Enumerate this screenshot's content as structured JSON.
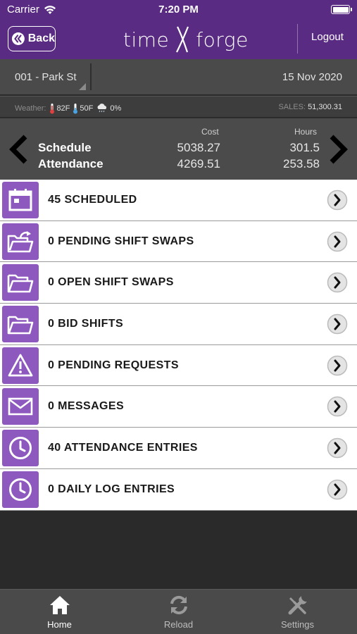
{
  "status_bar": {
    "carrier": "Carrier",
    "time": "7:20 PM"
  },
  "nav": {
    "back_label": "Back",
    "logo_left": "time",
    "logo_right": "forge",
    "logout_label": "Logout",
    "color": "#5a2b82"
  },
  "store_bar": {
    "store": "001 - Park St",
    "date": "15 Nov 2020"
  },
  "weather_bar": {
    "weather_label": "Weather:",
    "high": "82F",
    "low": "50F",
    "precip": "0%",
    "sales_label": "SALES:",
    "sales_value": "51,300.31"
  },
  "summary": {
    "cost_header": "Cost",
    "hours_header": "Hours",
    "rows": [
      {
        "label": "Schedule",
        "cost": "5038.27",
        "hours": "301.5"
      },
      {
        "label": "Attendance",
        "cost": "4269.51",
        "hours": "253.58"
      }
    ]
  },
  "list": {
    "accent": "#8d59be",
    "items": [
      {
        "label": "45 SCHEDULED",
        "icon": "calendar-icon"
      },
      {
        "label": "0 PENDING SHIFT SWAPS",
        "icon": "folder-swap-icon"
      },
      {
        "label": "0 OPEN SHIFT SWAPS",
        "icon": "folder-open-icon"
      },
      {
        "label": "0 BID SHIFTS",
        "icon": "folder-open-icon"
      },
      {
        "label": "0 PENDING REQUESTS",
        "icon": "warning-icon"
      },
      {
        "label": "0 MESSAGES",
        "icon": "envelope-icon"
      },
      {
        "label": "40 ATTENDANCE ENTRIES",
        "icon": "clock-icon"
      },
      {
        "label": "0 DAILY LOG ENTRIES",
        "icon": "clock-icon"
      }
    ]
  },
  "tabbar": {
    "tabs": [
      {
        "label": "Home",
        "icon": "home-icon",
        "active": true
      },
      {
        "label": "Reload",
        "icon": "reload-icon",
        "active": false
      },
      {
        "label": "Settings",
        "icon": "settings-icon",
        "active": false
      }
    ]
  }
}
